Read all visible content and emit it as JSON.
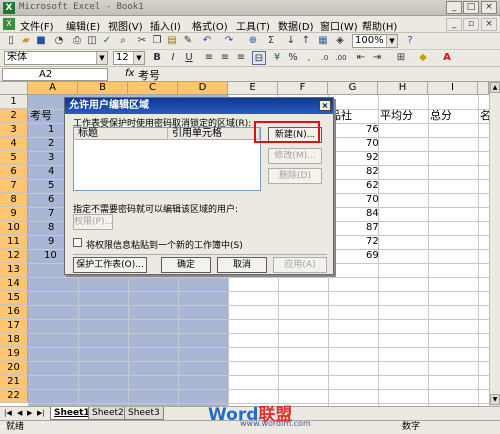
{
  "window": {
    "title": "Microsoft Excel - Book1"
  },
  "menu": [
    "文件(F)",
    "编辑(E)",
    "视图(V)",
    "插入(I)",
    "格式(O)",
    "工具(T)",
    "数据(D)",
    "窗口(W)",
    "帮助(H)"
  ],
  "toolbar": {
    "zoom": "100%",
    "font": "宋体",
    "size": "12"
  },
  "formula": {
    "namebox": "A2",
    "fx": "fx",
    "content": "考号"
  },
  "columns": [
    "A",
    "B",
    "C",
    "D",
    "E",
    "F",
    "G",
    "H",
    "I"
  ],
  "rows": [
    "1",
    "2",
    "3",
    "4",
    "5",
    "6",
    "7",
    "8",
    "9",
    "10",
    "11",
    "12",
    "13",
    "14",
    "15",
    "16",
    "17",
    "18",
    "19",
    "20",
    "21",
    "22"
  ],
  "cells": {
    "a2": "考号",
    "a_values": [
      "1",
      "2",
      "3",
      "4",
      "5",
      "6",
      "7",
      "8",
      "9",
      "10"
    ],
    "g2": "品社",
    "h2": "平均分",
    "i2": "总分",
    "g_values": [
      "76",
      "70",
      "92",
      "82",
      "62",
      "70",
      "84",
      "87",
      "72",
      "69"
    ]
  },
  "dialog": {
    "title": "允许用户编辑区域",
    "desc": "工作表受保护时使用密码取消锁定的区域(R):",
    "col_title": "标题",
    "col_ref": "引用单元格",
    "btn_new": "新建(N)...",
    "btn_modify": "修改(M)...",
    "btn_delete": "删除(D)",
    "perm_label": "指定不需要密码就可以编辑该区域的用户:",
    "btn_perm": "权限(P)...",
    "paste_label": "将权限信息粘贴到一个新的工作簿中(S)",
    "btn_protect": "保护工作表(O)...",
    "btn_ok": "确定",
    "btn_cancel": "取消",
    "btn_apply": "应用(A)"
  },
  "sheets": [
    "Sheet1",
    "Sheet2",
    "Sheet3"
  ],
  "status": {
    "left": "就绪",
    "mode": "数字"
  },
  "watermark": {
    "brand_word": "Word",
    "brand_cn": "联盟",
    "url": "www.wordlm.com"
  }
}
